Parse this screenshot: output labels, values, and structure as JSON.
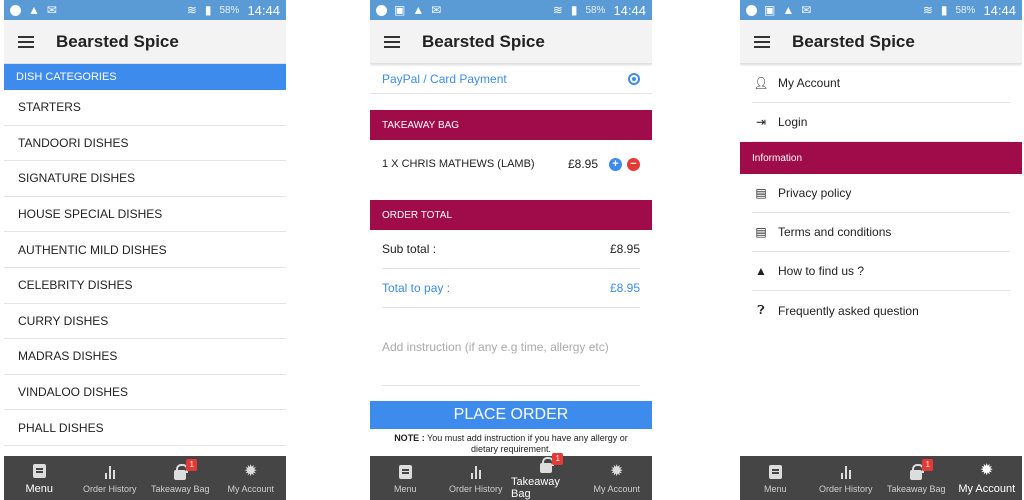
{
  "status": {
    "battery": "58%",
    "time": "14:44"
  },
  "app": {
    "title": "Bearsted Spice"
  },
  "nav": {
    "menu": "Menu",
    "order_history": "Order History",
    "takeaway_bag": "Takeaway Bag",
    "my_account": "My Account",
    "bag_count": "1"
  },
  "menu_screen": {
    "header": "DISH CATEGORIES",
    "categories": [
      "STARTERS",
      "TANDOORI DISHES",
      "SIGNATURE DISHES",
      "HOUSE SPECIAL DISHES",
      "AUTHENTIC MILD DISHES",
      "CELEBRITY DISHES",
      "CURRY DISHES",
      "MADRAS DISHES",
      "VINDALOO DISHES",
      "PHALL DISHES"
    ]
  },
  "bag_screen": {
    "payment_option": "PayPal / Card Payment",
    "bag_header": "TAKEAWAY BAG",
    "item_label": "1 X CHRIS MATHEWS (LAMB)",
    "item_price": "£8.95",
    "plus": "+",
    "minus": "−",
    "total_header": "ORDER TOTAL",
    "subtotal_label": "Sub total :",
    "subtotal_value": "£8.95",
    "topay_label": "Total to pay :",
    "topay_value": "£8.95",
    "instruction_placeholder": "Add instruction (if any e.g time, allergy etc)",
    "place_order": "PLACE ORDER",
    "note_label": "NOTE :",
    "note_text": " You must add instruction if you have any allergy or dietary requirement."
  },
  "account_screen": {
    "my_account": "My Account",
    "login": "Login",
    "info_header": "Information",
    "privacy": "Privacy policy",
    "terms": "Terms and conditions",
    "find_us": "How to find us ?",
    "faq": "Frequently asked question"
  },
  "colors": {
    "accent_blue": "#3d8bec",
    "maroon": "#a00b4a",
    "nav_bg": "#454545"
  }
}
